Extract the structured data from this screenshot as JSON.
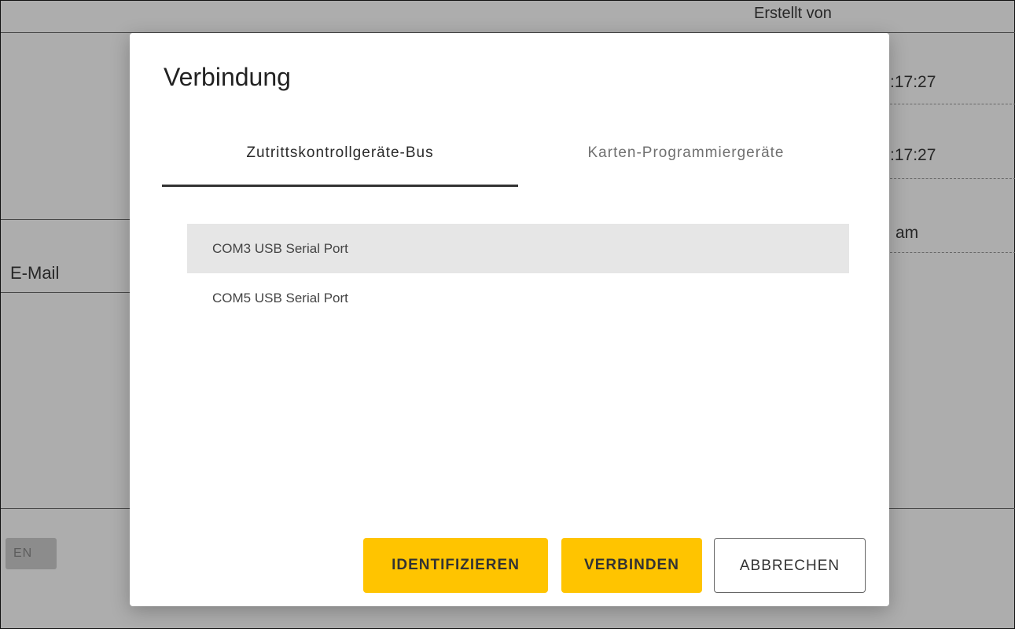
{
  "background": {
    "created_by_label": "Erstellt von",
    "row1_time": ":17:27",
    "row2_time": ":17:27",
    "row3_text": "am",
    "email_label": "E-Mail",
    "partial_button_label": "EN"
  },
  "dialog": {
    "title": "Verbindung",
    "tabs": [
      {
        "label": "Zutrittskontrollgeräte-Bus",
        "active": true
      },
      {
        "label": "Karten-Programmiergeräte",
        "active": false
      }
    ],
    "ports": [
      {
        "label": "COM3 USB Serial Port",
        "selected": true
      },
      {
        "label": "COM5 USB Serial Port",
        "selected": false
      }
    ],
    "buttons": {
      "identify": "IDENTIFIZIEREN",
      "connect": "VERBINDEN",
      "cancel": "ABBRECHEN"
    }
  },
  "colors": {
    "primary_button": "#ffc400",
    "selected_row": "#e6e6e6",
    "overlay": "rgba(0,0,0,0.32)"
  }
}
